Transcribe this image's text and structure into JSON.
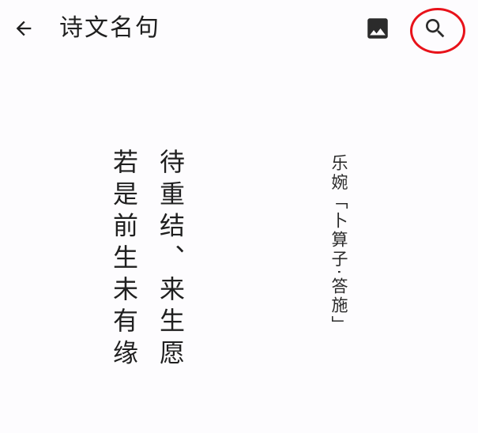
{
  "app_bar": {
    "title": "诗文名句",
    "back_icon": "arrow-left-icon",
    "image_icon": "image-icon",
    "search_icon": "search-icon"
  },
  "highlight_color": "#e8121a",
  "poem": {
    "lines": [
      "待重结、来生愿",
      "若是前生未有缘"
    ],
    "author": "乐婉",
    "source": "「卜算子·答施」"
  }
}
